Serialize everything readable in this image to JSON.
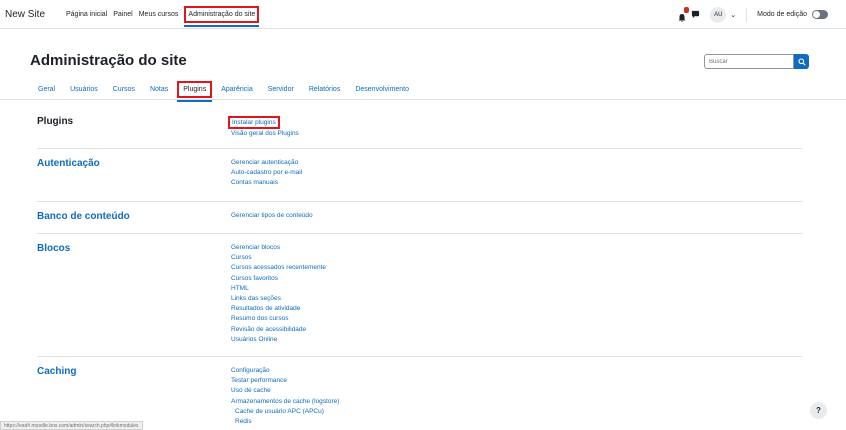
{
  "navbar": {
    "brand": "New Site",
    "items": [
      {
        "label": "Página inicial"
      },
      {
        "label": "Painel"
      },
      {
        "label": "Meus cursos"
      },
      {
        "label": "Administração do site"
      }
    ],
    "avatar_initials": "AU",
    "edit_mode_label": "Modo de edição"
  },
  "page": {
    "title": "Administração do site",
    "search_placeholder": "Buscar"
  },
  "tabs": [
    {
      "label": "Geral"
    },
    {
      "label": "Usuários"
    },
    {
      "label": "Cursos"
    },
    {
      "label": "Notas"
    },
    {
      "label": "Plugins"
    },
    {
      "label": "Aparência"
    },
    {
      "label": "Servidor"
    },
    {
      "label": "Relatórios"
    },
    {
      "label": "Desenvolvimento"
    }
  ],
  "sections": {
    "plugins": {
      "title": "Plugins",
      "links": [
        "Instalar plugins",
        "Visão geral dos Plugins"
      ]
    },
    "autenticacao": {
      "title": "Autenticação",
      "links": [
        "Gerenciar autenticação",
        "Auto-cadastro por e-mail",
        "Contas manuais"
      ]
    },
    "banco": {
      "title": "Banco de conteúdo",
      "links": [
        "Gerenciar tipos de conteúdo"
      ]
    },
    "blocos": {
      "title": "Blocos",
      "links": [
        "Gerenciar blocos",
        "Cursos",
        "Cursos acessados recentemente",
        "Cursos favoritos",
        "HTML",
        "Links das seções",
        "Resultados de atividade",
        "Resumo dos cursos",
        "Revisão de acessibilidade",
        "Usuários Online"
      ]
    },
    "caching": {
      "title": "Caching",
      "links": [
        "Configuração",
        "Testar performance",
        "Uso de cache",
        "Armazenamentos de cache (logstore)",
        "Cache de usuário APC (APCu)",
        "Redis"
      ]
    }
  },
  "status_url": "https://ead#.moodle.box.com/admin/search.php#linkmodules",
  "help_label": "?"
}
